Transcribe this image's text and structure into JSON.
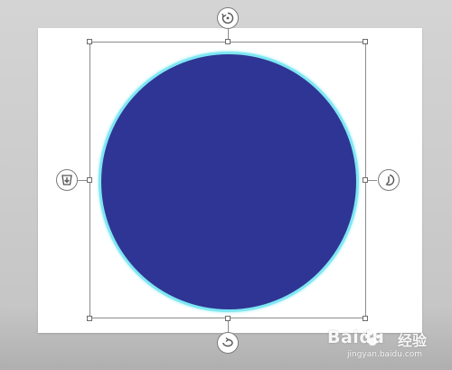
{
  "canvas": {
    "background_color": "#cccccc",
    "slide_color": "#ffffff"
  },
  "shape": {
    "type": "circle",
    "fill_color": "#2f3594",
    "outline_glow_color": "#7ee7f2",
    "selected": true
  },
  "selection": {
    "border_color": "#8c8c8c",
    "handles": [
      "top-left",
      "top",
      "top-right",
      "left",
      "right",
      "bottom-left",
      "bottom",
      "bottom-right"
    ]
  },
  "controls": {
    "top": {
      "icon": "rotate-icon"
    },
    "right": {
      "icon": "rotate-right-icon"
    },
    "bottom": {
      "icon": "flip-icon"
    },
    "left": {
      "icon": "download-icon"
    }
  },
  "watermark": {
    "brand": "Baidu",
    "brand_cn": "经验",
    "url": "jingyan.baidu.com"
  }
}
